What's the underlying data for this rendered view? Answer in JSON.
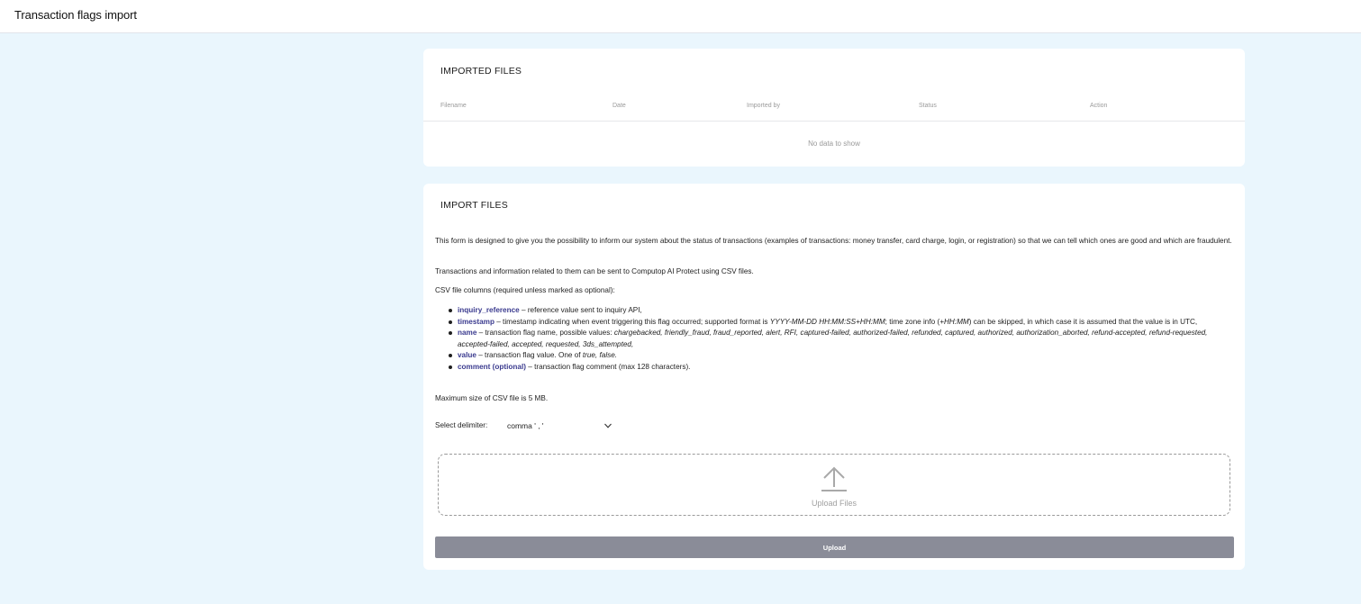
{
  "header": {
    "title": "Transaction flags import"
  },
  "imported_files": {
    "title": "IMPORTED FILES",
    "columns": [
      "Filename",
      "Date",
      "Imported by",
      "Status",
      "Action"
    ],
    "rows": [],
    "empty_text": "No data to show"
  },
  "import_files": {
    "title": "IMPORT FILES",
    "intro": "This form is designed to give you the possibility to inform our system about the status of transactions (examples of transactions: money transfer, card charge, login, or registration) so that we can tell which ones are good and which are fraudulent.",
    "csv_info": "Transactions and information related to them can be sent to Computop AI Protect using CSV files.",
    "columns_heading": "CSV file columns (required unless marked as optional):",
    "columns": [
      {
        "key": "inquiry_reference",
        "desc": " – reference value sent to inquiry API,"
      },
      {
        "key": "timestamp",
        "desc_a": " – timestamp indicating when event triggering this flag occurred; supported format is ",
        "format": "YYYY-MM-DD HH:MM:SS+HH:MM",
        "desc_b": "; time zone info (",
        "tz": "+HH:MM",
        "desc_c": ") can be skipped, in which case it is assumed that the value is in UTC,"
      },
      {
        "key": "name",
        "desc": " – transaction flag name, possible values: ",
        "values": "chargebacked, friendly_fraud, fraud_reported, alert, RFI, captured-failed, authorized-failed, refunded, captured, authorized, authorization_aborted, refund-accepted, refund-requested, accepted-failed, accepted, requested, 3ds_attempted,"
      },
      {
        "key": "value",
        "desc": " – transaction flag value. One of ",
        "values": "true, false."
      },
      {
        "key": "comment (optional)",
        "desc": " – transaction flag comment (max 128 characters)."
      }
    ],
    "max_size": "Maximum size of CSV file is 5 MB.",
    "delimiter_label": "Select delimiter:",
    "delimiter_value": "comma ' , '",
    "dropzone_text": "Upload Files",
    "upload_button": "Upload"
  },
  "icons": {
    "upload": "upload-arrow-icon",
    "dropdown": "chevron-down-icon"
  },
  "colors": {
    "background": "#eaf6fd",
    "card": "#ffffff",
    "keyword": "#3b3b8f",
    "button": "#8a8c98"
  }
}
